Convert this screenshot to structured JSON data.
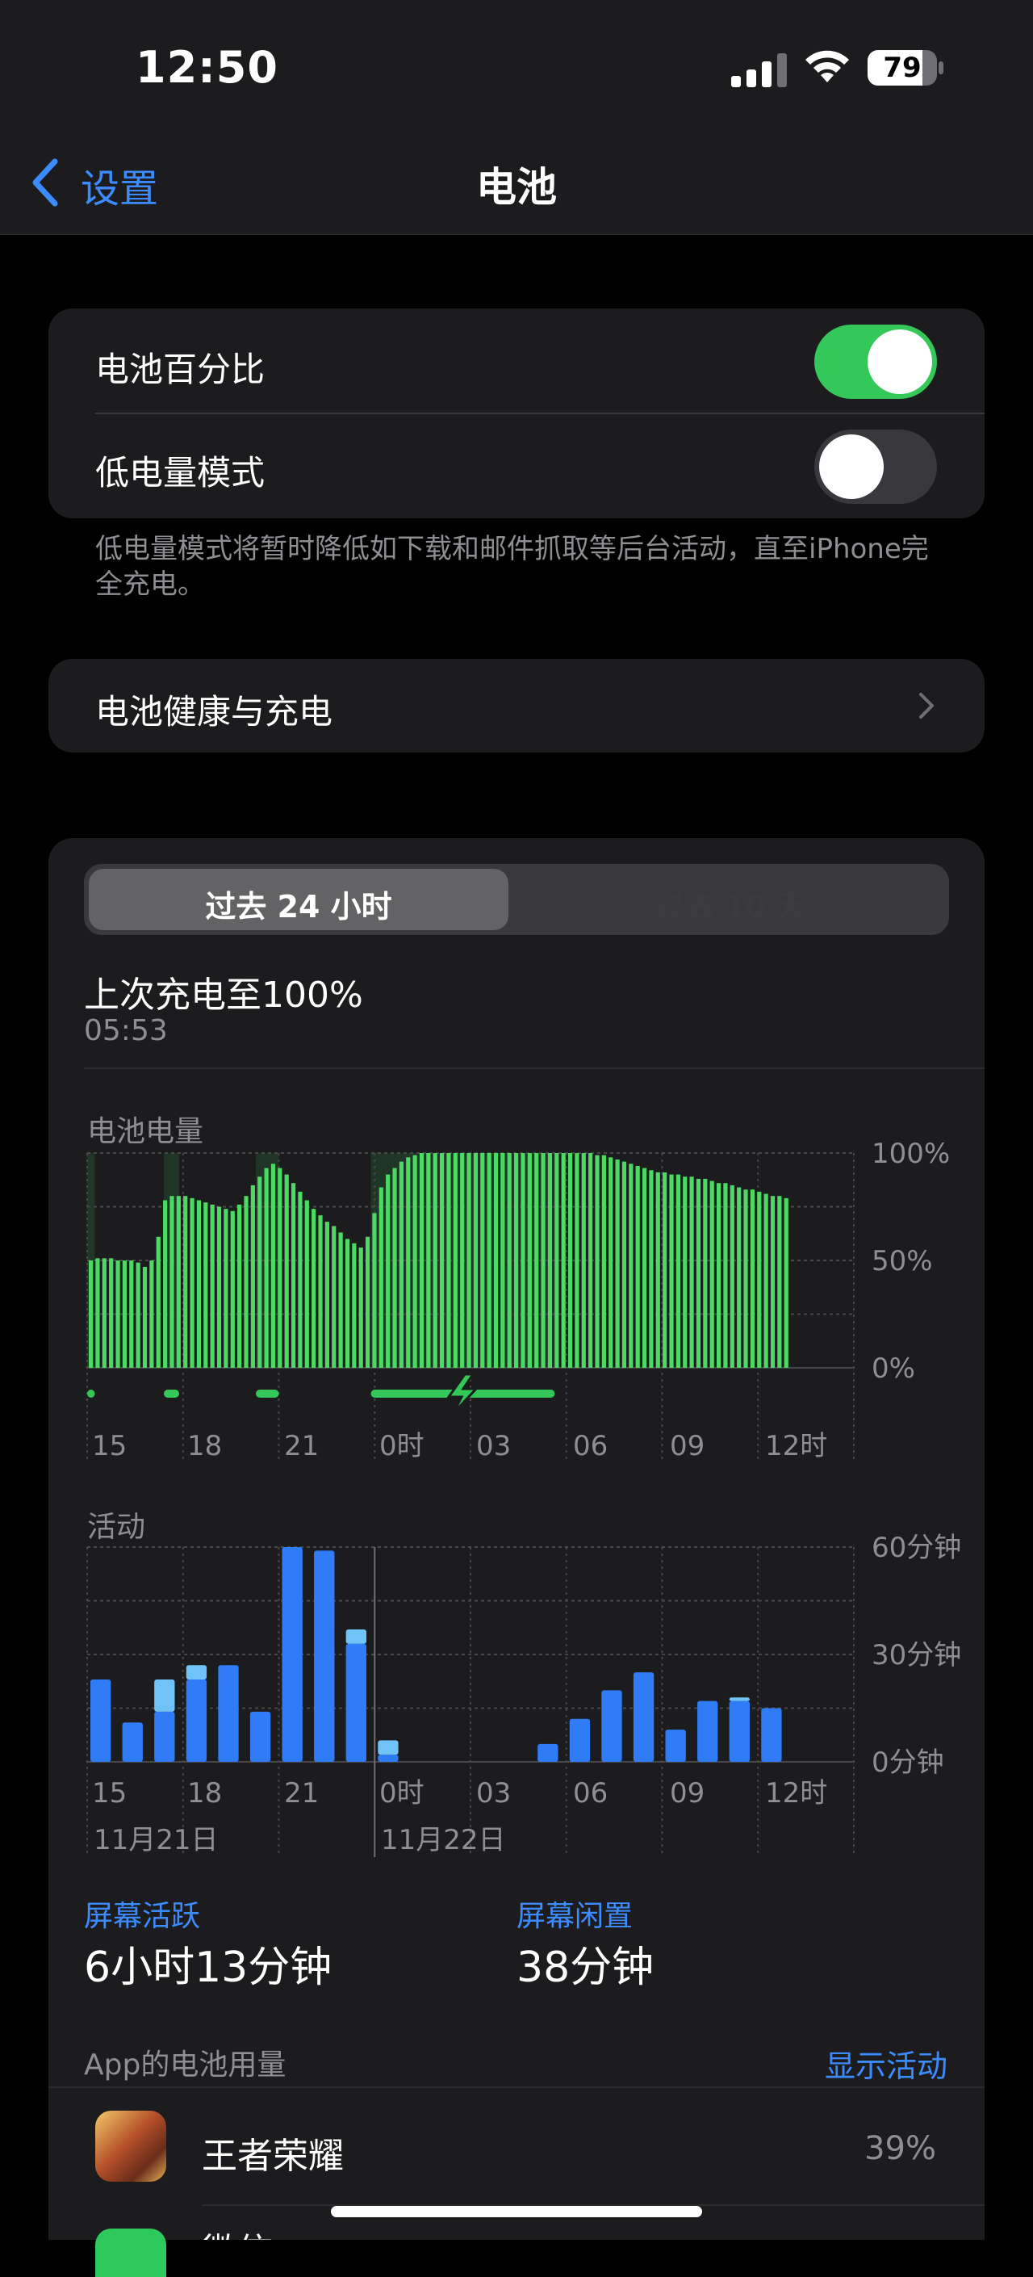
{
  "status_bar": {
    "time": "12:50",
    "battery_level": "79"
  },
  "nav": {
    "back_label": "设置",
    "title": "电池"
  },
  "settings": {
    "battery_percentage": {
      "label": "电池百分比",
      "enabled": true
    },
    "low_power_mode": {
      "label": "低电量模式",
      "enabled": false
    },
    "footnote": "低电量模式将暂时降低如下载和邮件抓取等后台活动，直至iPhone完全充电。"
  },
  "battery_health": {
    "label": "电池健康与充电"
  },
  "usage": {
    "segments": [
      "过去 24 小时",
      "过去 10 天"
    ],
    "last_charge": "上次充电至100%",
    "last_charge_time": "05:53",
    "level_title": "电池电量",
    "activity_title": "活动",
    "screen_on_label": "屏幕活跃",
    "screen_on_value": "6小时13分钟",
    "screen_idle_label": "屏幕闲置",
    "screen_idle_value": "38分钟",
    "app_usage_header": "App的电池用量",
    "show_activity": "显示活动",
    "apps": [
      {
        "name": "王者荣耀",
        "percent": "39%"
      },
      {
        "name": "微信",
        "percent": ""
      }
    ]
  },
  "colors": {
    "accent": "#3d8cff",
    "green": "#34c759",
    "bar_blue": "#2f7cf6",
    "bar_light_blue": "#6fc3f7"
  },
  "chart_data": [
    {
      "type": "bar",
      "title": "电池电量",
      "x_tick_labels": [
        "15",
        "18",
        "21",
        "0时",
        "03",
        "06",
        "09",
        "12时"
      ],
      "y_tick_labels": [
        "100%",
        "50%",
        "0%"
      ],
      "ylim": [
        0,
        100
      ],
      "values": [
        50,
        51,
        51,
        51,
        50,
        50,
        50,
        49,
        47,
        50,
        61,
        78,
        80,
        80,
        80,
        79,
        78,
        77,
        76,
        75,
        74,
        73,
        76,
        80,
        85,
        89,
        93,
        95,
        93,
        90,
        86,
        82,
        78,
        74,
        71,
        68,
        66,
        63,
        60,
        58,
        56,
        61,
        72,
        84,
        90,
        93,
        96,
        98,
        99,
        100,
        100,
        100,
        100,
        100,
        100,
        100,
        100,
        100,
        100,
        100,
        100,
        100,
        100,
        100,
        100,
        100,
        100,
        100,
        100,
        100,
        100,
        100,
        100,
        100,
        100,
        99,
        99,
        98,
        97,
        96,
        95,
        94,
        93,
        92,
        91,
        91,
        90,
        90,
        89,
        89,
        88,
        88,
        87,
        86,
        86,
        85,
        84,
        83,
        83,
        82,
        81,
        80,
        80,
        79
      ],
      "charging": [
        [
          0,
          0.01
        ],
        [
          0.1,
          0.12
        ],
        [
          0.22,
          0.25
        ],
        [
          0.37,
          0.61
        ]
      ]
    },
    {
      "type": "bar",
      "title": "活动",
      "x_tick_labels": [
        "15",
        "18",
        "21",
        "0时",
        "03",
        "06",
        "09",
        "12时"
      ],
      "y_tick_labels": [
        "60分钟",
        "30分钟",
        "0分钟"
      ],
      "date_labels": [
        "11月21日",
        "11月22日"
      ],
      "ylim": [
        0,
        60
      ],
      "series": [
        {
          "name": "屏幕活跃",
          "values": [
            23,
            11,
            14,
            23,
            27,
            14,
            60,
            59,
            33,
            2,
            0,
            0,
            0,
            0,
            5,
            12,
            20,
            25,
            9,
            17,
            17,
            15
          ]
        },
        {
          "name": "屏幕闲置",
          "values": [
            0,
            0,
            9,
            4,
            0,
            0,
            0,
            0,
            4,
            4,
            0,
            0,
            0,
            0,
            0,
            0,
            0,
            0,
            0,
            0,
            1,
            0
          ]
        }
      ]
    }
  ]
}
